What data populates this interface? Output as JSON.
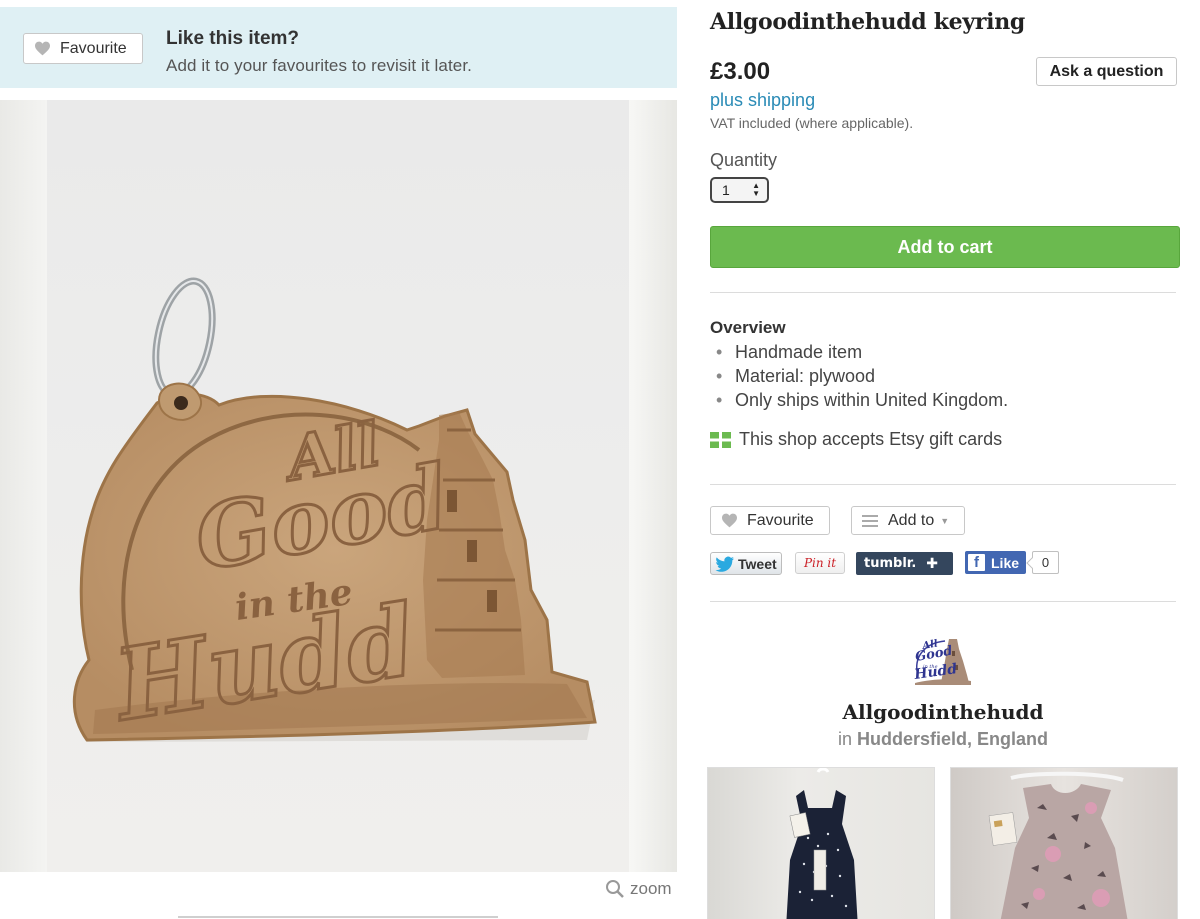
{
  "favourite_banner": {
    "button_label": "Favourite",
    "title": "Like this item?",
    "subtitle": "Add it to your favourites to revisit it later."
  },
  "product_image": {
    "zoom_label": "zoom",
    "logo_text": [
      "All",
      "Good",
      "in the",
      "Hudd"
    ]
  },
  "listing": {
    "title": "Allgoodinthehudd keyring",
    "price": "£3.00",
    "ask_label": "Ask a question",
    "shipping_label": "plus shipping",
    "vat_note": "VAT included (where applicable).",
    "quantity_label": "Quantity",
    "quantity_value": "1",
    "add_to_cart_label": "Add to cart"
  },
  "overview": {
    "title": "Overview",
    "items": [
      "Handmade item",
      "Material: plywood",
      "Only ships within United Kingdom."
    ],
    "gift_cards": "This shop accepts Etsy gift cards"
  },
  "actions": {
    "favourite_label": "Favourite",
    "add_to_label": "Add to"
  },
  "social": {
    "tweet_label": "Tweet",
    "pin_label": "Pin it",
    "tumblr_label": "tumblr.",
    "like_label": "Like",
    "like_count": "0"
  },
  "shop": {
    "name": "Allgoodinthehudd",
    "location_prefix": "in",
    "location": "Huddersfield, England"
  },
  "colors": {
    "banner_bg": "#dff0f4",
    "link": "#2a8bb6",
    "cart_green": "#6bba4f",
    "facebook": "#4267b2",
    "tumblr": "#34465d"
  }
}
